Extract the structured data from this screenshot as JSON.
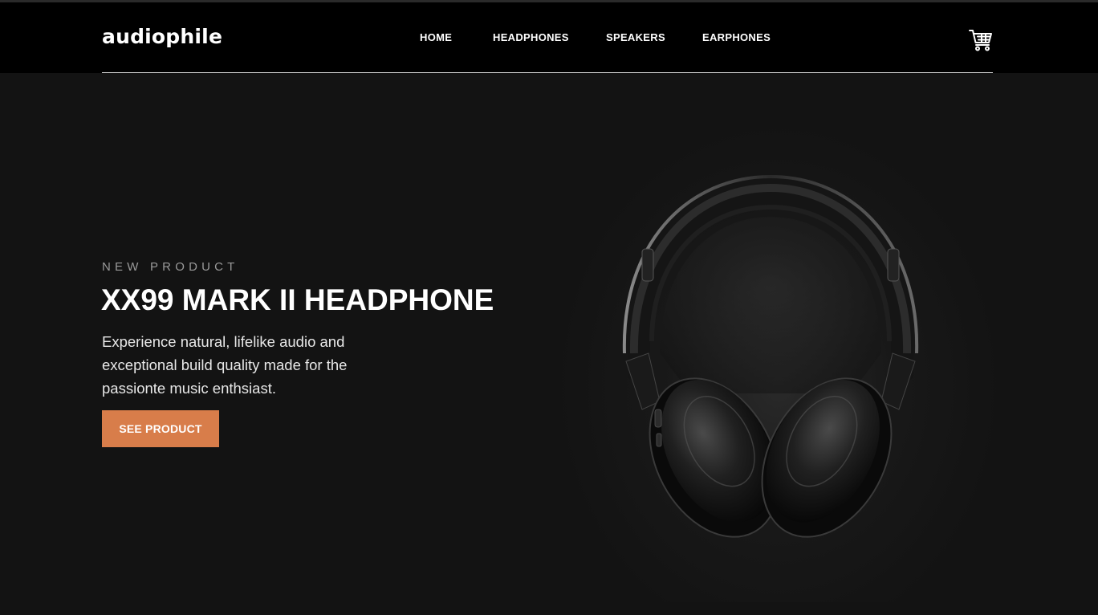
{
  "header": {
    "logo": "audiophile",
    "nav": [
      {
        "label": "HOME"
      },
      {
        "label": "HEADPHONES"
      },
      {
        "label": "SPEAKERS"
      },
      {
        "label": "EARPHONES"
      }
    ],
    "cart_icon": "cart-icon"
  },
  "hero": {
    "overline": "NEW PRODUCT",
    "title": "XX99 MARK II HEADPHONE",
    "description": "Experience natural, lifelike audio and exceptional build quality made for the passionte music enthsiast.",
    "cta_label": "SEE PRODUCT",
    "image_icon": "headphone-image"
  },
  "colors": {
    "accent": "#d87d4a",
    "header_bg": "#000000",
    "hero_bg": "#131313",
    "text": "#ffffff"
  }
}
